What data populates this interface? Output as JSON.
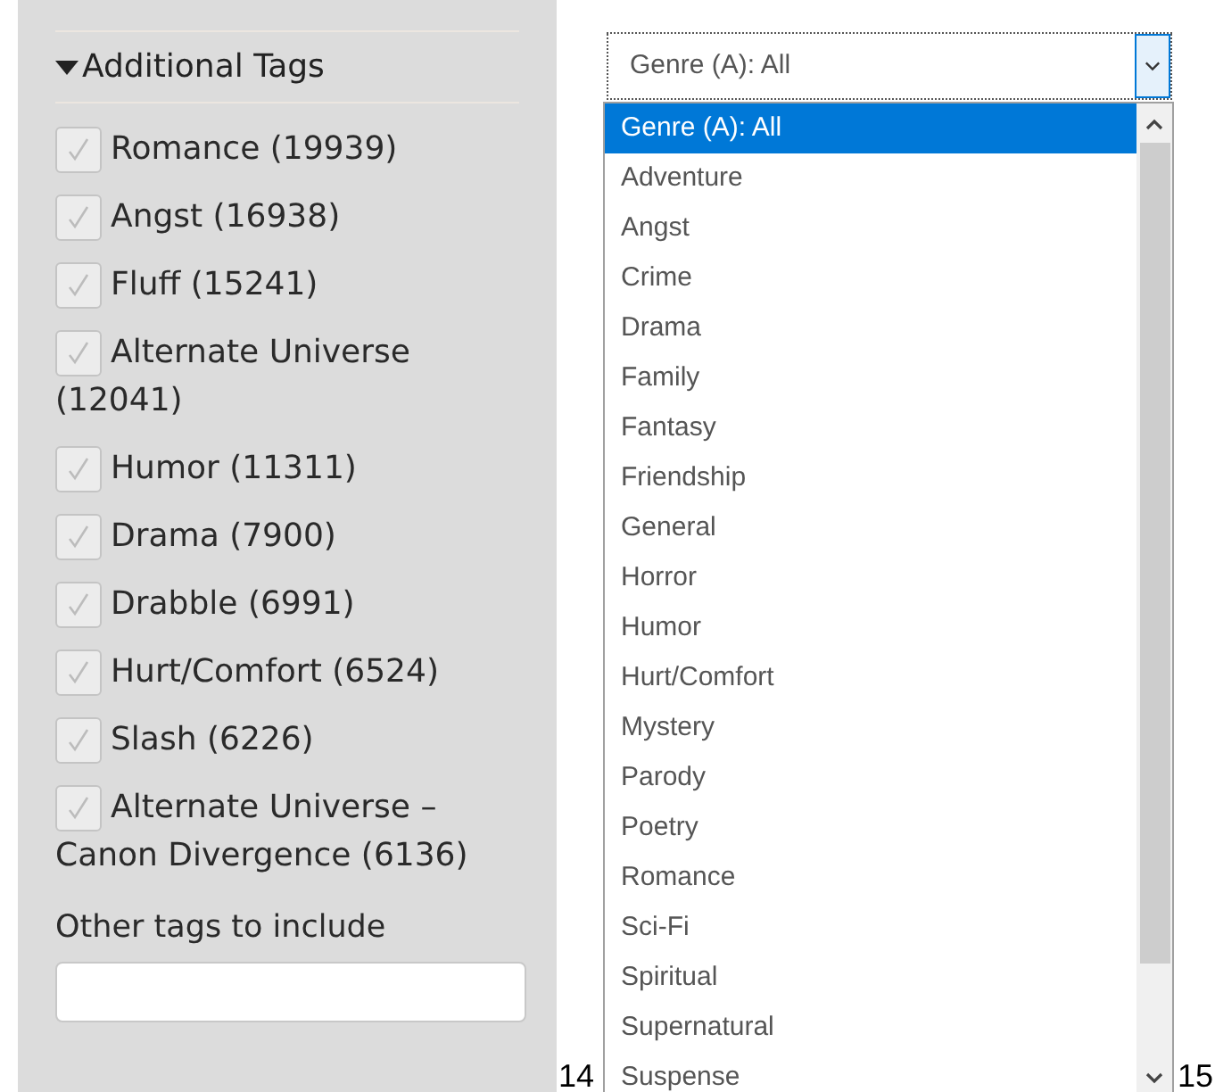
{
  "filters": {
    "heading": "Additional Tags",
    "expanded": true,
    "tags": [
      {
        "label": "Romance (19939)",
        "checked": true
      },
      {
        "label": "Angst (16938)",
        "checked": true
      },
      {
        "label": "Fluff (15241)",
        "checked": true
      },
      {
        "label": "Alternate Universe (12041)",
        "checked": true
      },
      {
        "label": "Humor (11311)",
        "checked": true
      },
      {
        "label": "Drama (7900)",
        "checked": true
      },
      {
        "label": "Drabble (6991)",
        "checked": true
      },
      {
        "label": "Hurt/Comfort (6524)",
        "checked": true
      },
      {
        "label": "Slash (6226)",
        "checked": true
      },
      {
        "label": "Alternate Universe – Canon Divergence (6136)",
        "checked": true
      }
    ],
    "other_tags": {
      "label": "Other tags to include"
    }
  },
  "page_numbers": [
    "14",
    "15"
  ],
  "genre_select": {
    "value": "Genre (A): All",
    "options": [
      {
        "label": "Genre (A): All",
        "selected": true
      },
      {
        "label": "Adventure",
        "selected": false
      },
      {
        "label": "Angst",
        "selected": false
      },
      {
        "label": "Crime",
        "selected": false
      },
      {
        "label": "Drama",
        "selected": false
      },
      {
        "label": "Family",
        "selected": false
      },
      {
        "label": "Fantasy",
        "selected": false
      },
      {
        "label": "Friendship",
        "selected": false
      },
      {
        "label": "General",
        "selected": false
      },
      {
        "label": "Horror",
        "selected": false
      },
      {
        "label": "Humor",
        "selected": false
      },
      {
        "label": "Hurt/Comfort",
        "selected": false
      },
      {
        "label": "Mystery",
        "selected": false
      },
      {
        "label": "Parody",
        "selected": false
      },
      {
        "label": "Poetry",
        "selected": false
      },
      {
        "label": "Romance",
        "selected": false
      },
      {
        "label": "Sci-Fi",
        "selected": false
      },
      {
        "label": "Spiritual",
        "selected": false
      },
      {
        "label": "Supernatural",
        "selected": false
      },
      {
        "label": "Suspense",
        "selected": false
      }
    ]
  }
}
